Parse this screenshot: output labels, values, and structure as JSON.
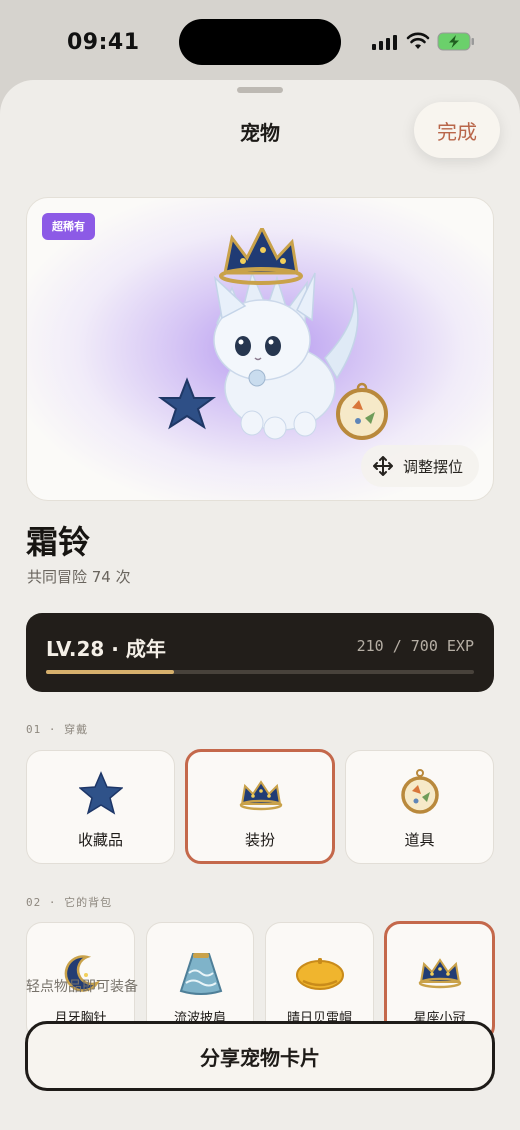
{
  "status_bar": {
    "time": "09:41"
  },
  "sheet": {
    "title": "宠物",
    "done_label": "完成"
  },
  "pet": {
    "rarity": "超稀有",
    "adjust_label": "调整摆位",
    "name": "霜铃",
    "adventures": "共同冒险 74 次",
    "level_label": "LV.28 · 成年",
    "exp_text": "210 / 700 EXP",
    "exp_progress": 0.3
  },
  "wear": {
    "section_label": "01 · 穿戴",
    "tiles": [
      {
        "label": "收藏品",
        "icon": "star-icon",
        "selected": false
      },
      {
        "label": "装扮",
        "icon": "crown-icon",
        "selected": true
      },
      {
        "label": "道具",
        "icon": "pocket-watch-icon",
        "selected": false
      }
    ]
  },
  "bag": {
    "section_label": "02 · 它的背包",
    "items": [
      {
        "label": "月牙胸针",
        "icon": "crescent-brooch-icon",
        "selected": false
      },
      {
        "label": "流波披肩",
        "icon": "wave-cape-icon",
        "selected": false
      },
      {
        "label": "晴日贝雷帽",
        "icon": "beret-icon",
        "selected": false
      },
      {
        "label": "星座小冠",
        "icon": "crown-icon",
        "selected": true
      }
    ],
    "hint": "轻点物品即可装备"
  },
  "save_label": "分享宠物卡片",
  "colors": {
    "accent": "#c4684b",
    "rarity": "#8c5ae6",
    "level_bg": "#221e1a",
    "exp_fill": "#d7b06c"
  }
}
